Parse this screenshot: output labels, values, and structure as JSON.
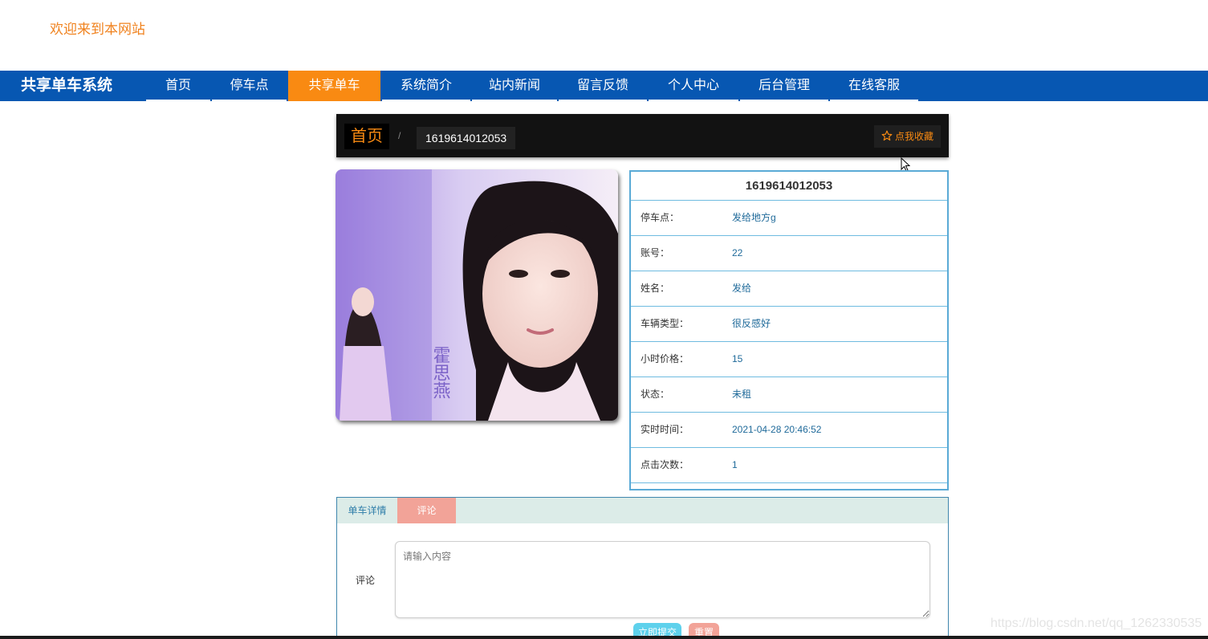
{
  "header": {
    "welcome": "欢迎来到本网站"
  },
  "nav": {
    "brand": "共享单车系统",
    "items": [
      {
        "label": "首页"
      },
      {
        "label": "停车点"
      },
      {
        "label": "共享单车"
      },
      {
        "label": "系统简介"
      },
      {
        "label": "站内新闻"
      },
      {
        "label": "留言反馈"
      },
      {
        "label": "个人中心"
      },
      {
        "label": "后台管理"
      },
      {
        "label": "在线客服"
      }
    ],
    "active": "共享单车"
  },
  "breadcrumb": {
    "home": "首页",
    "separator": "/",
    "current": "1619614012053",
    "favorite": "点我收藏"
  },
  "detail": {
    "title": "1619614012053",
    "rows": [
      {
        "label": "停车点：",
        "value": "发给地方g"
      },
      {
        "label": "账号：",
        "value": "22"
      },
      {
        "label": "姓名：",
        "value": "发给"
      },
      {
        "label": "车辆类型：",
        "value": "很反感好"
      },
      {
        "label": "小时价格：",
        "value": "15"
      },
      {
        "label": "状态：",
        "value": "未租"
      },
      {
        "label": "实时时间：",
        "value": "2021-04-28 20:46:52"
      },
      {
        "label": "点击次数：",
        "value": "1"
      }
    ]
  },
  "tabs": {
    "detail": "单车详情",
    "comment": "评论",
    "active": "评论"
  },
  "comment_form": {
    "label": "评论",
    "placeholder": "请输入内容",
    "value": "",
    "submit": "立即提交",
    "reset": "重置"
  },
  "photo": {
    "overlay_text": "霍思燕"
  },
  "watermark": "https://blog.csdn.net/qq_1262330535",
  "colors": {
    "brand_blue": "#0757b2",
    "accent_orange": "#f98a12",
    "welcome_orange": "#f0821e",
    "panel_border": "#5aaad6",
    "tab_active": "#f2a398",
    "submit_cyan": "#5ed1ec"
  }
}
